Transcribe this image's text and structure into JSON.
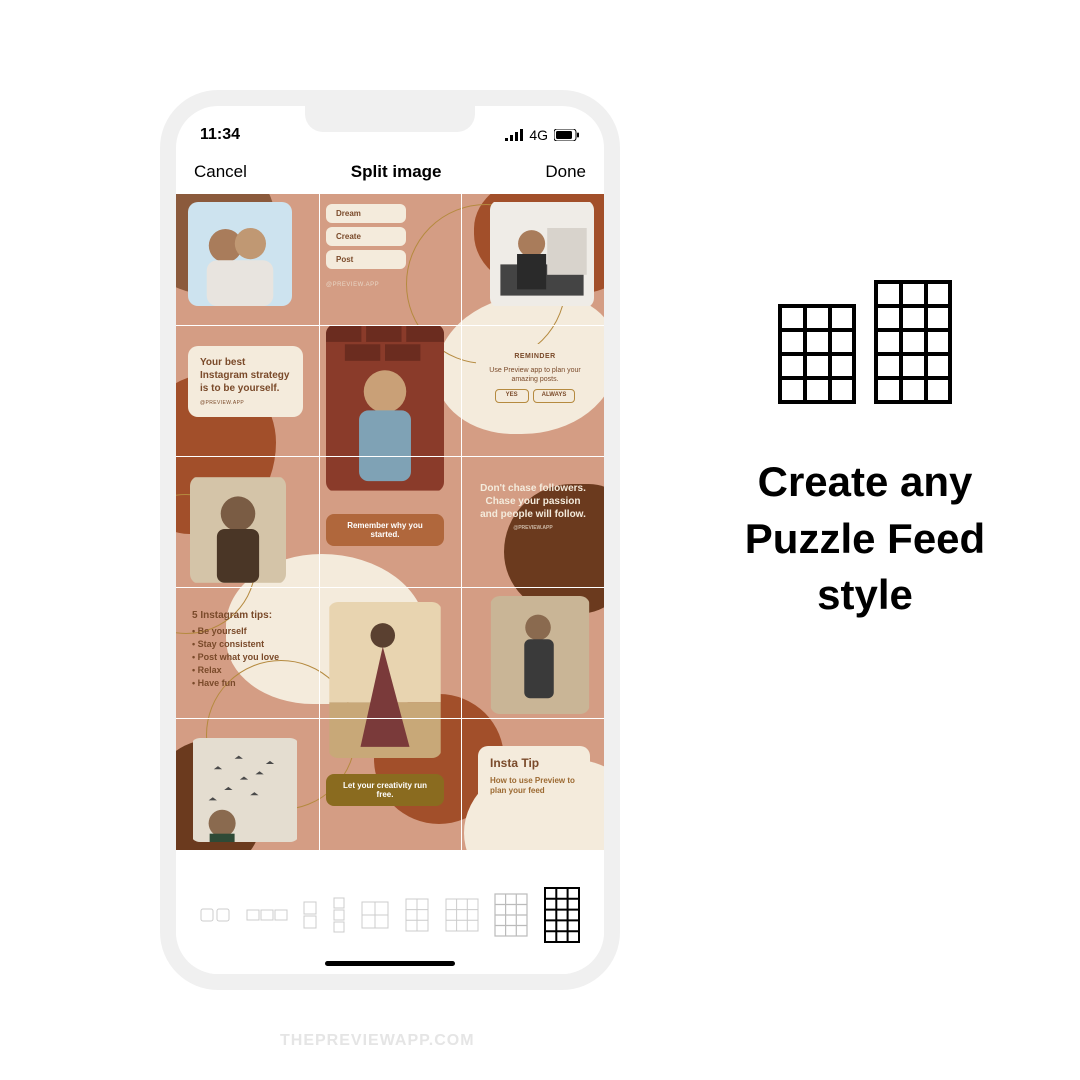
{
  "status": {
    "time": "11:34",
    "network": "4G"
  },
  "nav": {
    "cancel": "Cancel",
    "title": "Split image",
    "done": "Done"
  },
  "side": {
    "headline": "Create any Puzzle Feed style"
  },
  "feed": {
    "pills": [
      "Dream",
      "Create",
      "Post"
    ],
    "handle": "@PREVIEW.APP",
    "quote1": "Your best Instagram strategy is to be yourself.",
    "reminder_title": "REMINDER",
    "reminder_body": "Use Preview app to plan your amazing posts.",
    "reminder_yes": "YES",
    "reminder_always": "ALWAYS",
    "remember": "Remember why you started.",
    "chase": "Don't chase followers. Chase your passion and people will follow.",
    "tips_title": "5 Instagram tips:",
    "tips": [
      "Be yourself",
      "Stay consistent",
      "Post what you love",
      "Relax",
      "Have fun"
    ],
    "creativity": "Let your creativity run free.",
    "insta_tip_title": "Insta Tip",
    "insta_tip_body": "How to use Preview to plan your feed"
  },
  "watermark": "THEPREVIEWAPP.COM"
}
